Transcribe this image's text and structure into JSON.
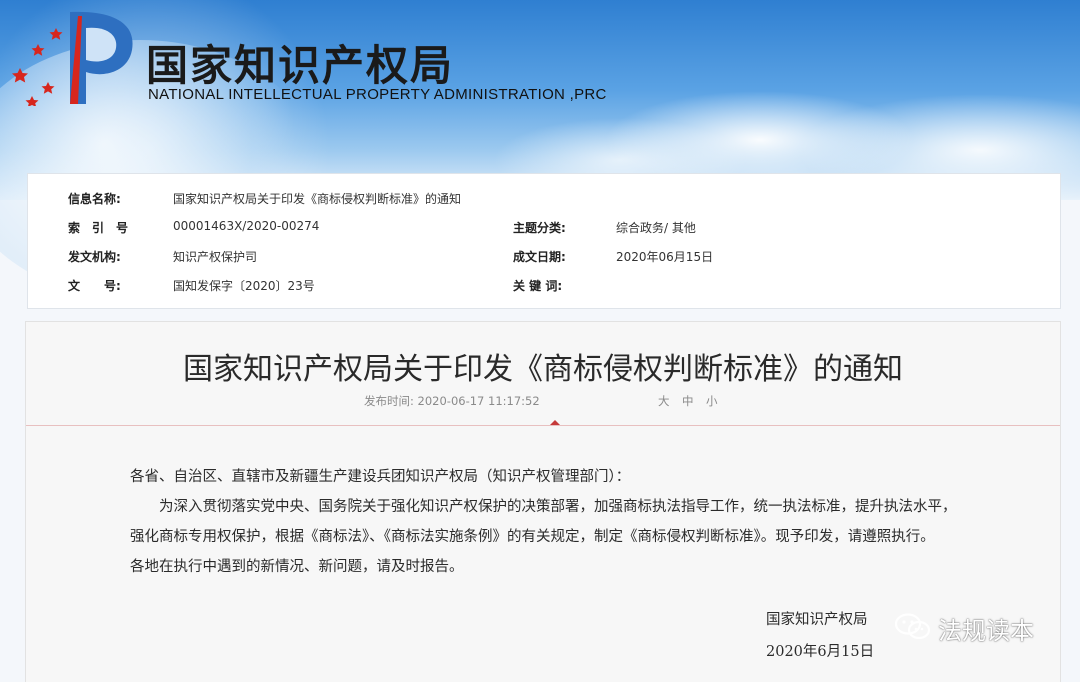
{
  "header": {
    "site_title": "国家知识产权局",
    "site_subtitle": "NATIONAL INTELLECTUAL PROPERTY ADMINISTRATION ,PRC"
  },
  "info": {
    "name_label": "信息名称:",
    "name_value": "国家知识产权局关于印发《商标侵权判断标准》的通知",
    "index_label": "索　引　号",
    "index_value": "00001463X/2020-00274",
    "topic_label": "主题分类:",
    "topic_value": "综合政务/ 其他",
    "issuer_label": "发文机构:",
    "issuer_value": "知识产权保护司",
    "date_label": "成文日期:",
    "date_value": "2020年06月15日",
    "docno_label": "文　　号:",
    "docno_value": "国知发保字〔2020〕23号",
    "keywords_label": "关 键 词:",
    "keywords_value": ""
  },
  "article": {
    "title": "国家知识产权局关于印发《商标侵权判断标准》的通知",
    "publish_time": "发布时间: 2020-06-17 11:17:52",
    "font_sizes": [
      "大",
      "中",
      "小"
    ],
    "paragraphs": [
      "各省、自治区、直辖市及新疆生产建设兵团知识产权局（知识产权管理部门）：",
      "为深入贯彻落实党中央、国务院关于强化知识产权保护的决策部署，加强商标执法指导工作，统一执法标准，提升执法水平，",
      "强化商标专用权保护，根据《商标法》、《商标法实施条例》的有关规定，制定《商标侵权判断标准》。现予印发，请遵照执行。",
      "各地在执行中遇到的新情况、新问题，请及时报告。"
    ],
    "signature_org": "国家知识产权局",
    "signature_date": "2020年6月15日"
  },
  "watermark": {
    "text": "法规读本",
    "icon": "wechat-icon"
  },
  "colors": {
    "emblem_red": "#d7261d",
    "emblem_blue": "#2e6fc0",
    "divider_accent": "#c53a3a"
  }
}
